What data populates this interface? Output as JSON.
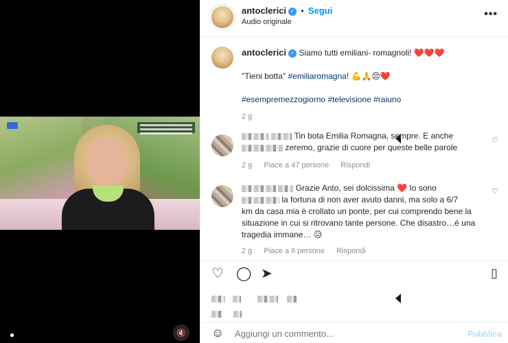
{
  "post_author": {
    "username": "antoclerici",
    "follow_label": "Segui",
    "audio_label": "Audio originale",
    "more_label": "•••"
  },
  "caption": {
    "username": "antoclerici",
    "line1": "Siamo tutti emiliani- romagnoli!",
    "line1_emoji": "❤️❤️❤️",
    "line2_quote": "\"Tieni botta\"",
    "line2_hashtag": "#emiliaromagna!",
    "line2_emoji": "💪🙏😔❤️",
    "hashtags": [
      "#esempremezzogiorno",
      "#televisione",
      "#raiuno"
    ],
    "time": "2 g"
  },
  "comments": [
    {
      "text_part1": "Tin bota Emilia Romagna, sempre. E anche",
      "text_part2": "zeremo, grazie di cuore per queste belle parole",
      "time": "2 g",
      "likes": "Piace a 47 persone",
      "reply_label": "Rispondi"
    },
    {
      "text_part1": "Grazie Anto, sei dolcissima",
      "text_part1_emoji": "❤️",
      "text_part1b": "Io sono",
      "text_part2": "la fortuna di non aver avuto danni, ma solo a 6/7",
      "text_part3": "km da casa mia è crollato un ponte, per cui comprendo bene la situazione in cui si ritrovano tante persone. Che disastro…é una tragedia immane…",
      "text_emoji_end": "😥",
      "time": "2 g",
      "likes": "Piace a 6 persone",
      "reply_label": "Rispondi"
    }
  ],
  "comment_box": {
    "placeholder": "Aggiungi un commento...",
    "publish_label": "Pubblica"
  },
  "colors": {
    "link_blue": "#0095f6",
    "hashtag_blue": "#00376b",
    "heart_red": "#ed4956",
    "muted_text": "#8e8e8e"
  },
  "icons": {
    "like": "heart-icon",
    "comment": "comment-icon",
    "share": "share-icon",
    "save": "bookmark-icon",
    "emoji": "emoji-icon",
    "mute": "muted-speaker-icon",
    "user_tag": "user-tag-icon",
    "verified": "verified-badge-icon"
  }
}
